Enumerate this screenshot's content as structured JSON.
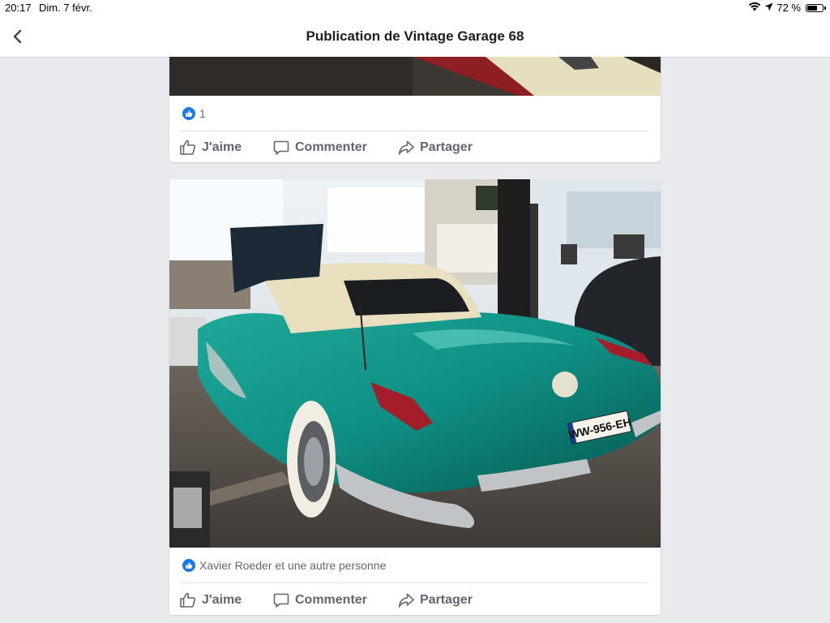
{
  "status_bar": {
    "time": "20:17",
    "date": "Dim. 7 févr.",
    "battery_text": "72 %",
    "battery_level": 0.72
  },
  "nav": {
    "back_icon": "chevron-left-icon",
    "title": "Publication de Vintage Garage 68"
  },
  "posts": [
    {
      "photo_description_icon": "car-photo",
      "reactions_text": "1",
      "actions": {
        "like": "J'aime",
        "comment": "Commenter",
        "share": "Partager"
      }
    },
    {
      "photo_description_icon": "car-photo",
      "plate_text": "WW-956-EH",
      "reactions_text": "Xavier Roeder et une autre personne",
      "actions": {
        "like": "J'aime",
        "comment": "Commenter",
        "share": "Partager"
      }
    }
  ],
  "colors": {
    "background": "#e9eaee",
    "card": "#ffffff",
    "like_blue": "#1877f2",
    "action_text": "#606770",
    "car_teal": "#0f8f84"
  }
}
